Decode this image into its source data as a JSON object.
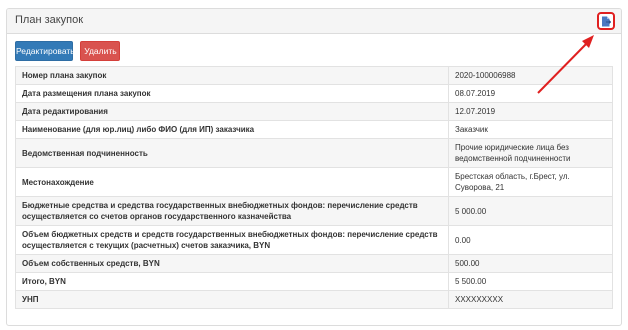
{
  "panel": {
    "title": "План закупок",
    "export_icon": "document-export-icon"
  },
  "actions": {
    "edit_label": "Редактировать",
    "delete_label": "Удалить"
  },
  "rows": [
    {
      "label": "Номер плана закупок",
      "value": "2020-100006988"
    },
    {
      "label": "Дата размещения плана закупок",
      "value": "08.07.2019"
    },
    {
      "label": "Дата редактирования",
      "value": "12.07.2019"
    },
    {
      "label": "Наименование (для юр.лиц) либо ФИО (для ИП) заказчика",
      "value": "Заказчик"
    },
    {
      "label": "Ведомственная подчиненность",
      "value": "Прочие юридические лица без ведомственной подчиненности"
    },
    {
      "label": "Местонахождение",
      "value": "Брестская область, г.Брест, ул. Суворова, 21"
    },
    {
      "label": "Бюджетные средства и средства государственных внебюджетных фондов: перечисление средств осуществляется со счетов органов государственного казначейства",
      "value": "5 000.00"
    },
    {
      "label": "Объем бюджетных средств и средств государственных внебюджетных фондов: перечисление средств осуществляется с текущих (расчетных) счетов заказчика, BYN",
      "value": "0.00"
    },
    {
      "label": "Объем собственных средств, BYN",
      "value": "500.00"
    },
    {
      "label": "Итого, BYN",
      "value": "5 500.00"
    },
    {
      "label": "УНП",
      "value": "XXXXXXXXX"
    }
  ],
  "colors": {
    "primary": "#337ab7",
    "danger": "#d9534f",
    "annotation": "#e02020"
  }
}
